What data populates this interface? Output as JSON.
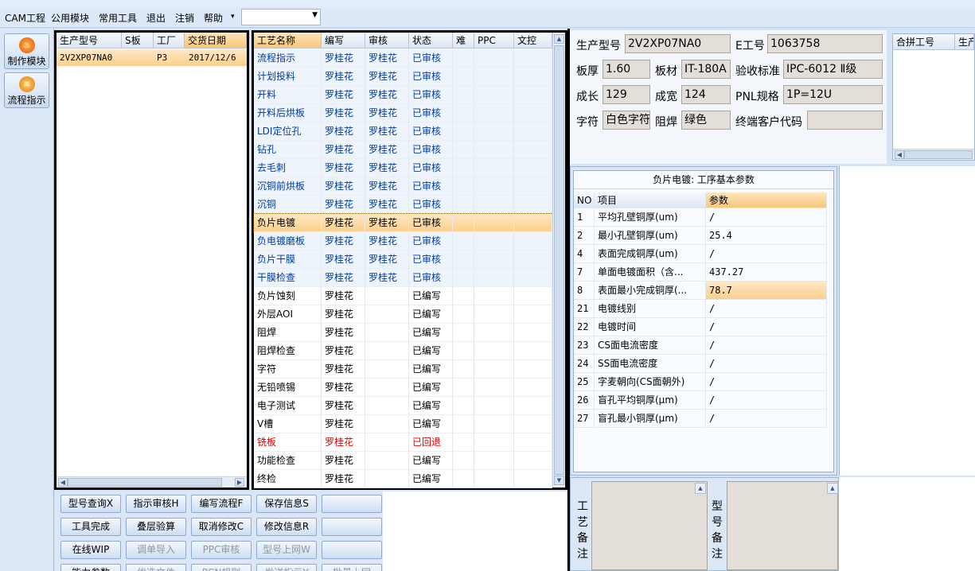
{
  "menu": {
    "items": [
      "CAM工程",
      "公用模块",
      "常用工具",
      "退出",
      "注销",
      "帮助"
    ],
    "dropdown_arrow": "▾",
    "combo_value": ""
  },
  "left_nav": {
    "make_module": "制作模块",
    "process_guide": "流程指示"
  },
  "product_grid": {
    "headers": [
      "生产型号",
      "S板",
      "工厂",
      "交货日期"
    ],
    "rows": [
      {
        "model": "2V2XP07NA0",
        "s_board": "",
        "factory": "P3",
        "delivery_date": "2017/12/6"
      }
    ]
  },
  "steps_grid": {
    "headers": [
      "工艺名称",
      "编写",
      "审核",
      "状态",
      "难",
      "PPC",
      "文控"
    ],
    "selected_index": 9,
    "rows": [
      {
        "name": "流程指示",
        "writer": "罗桂花",
        "reviewer": "罗桂花",
        "status": "已审核"
      },
      {
        "name": "计划投料",
        "writer": "罗桂花",
        "reviewer": "罗桂花",
        "status": "已审核"
      },
      {
        "name": "开料",
        "writer": "罗桂花",
        "reviewer": "罗桂花",
        "status": "已审核"
      },
      {
        "name": "开料后烘板",
        "writer": "罗桂花",
        "reviewer": "罗桂花",
        "status": "已审核"
      },
      {
        "name": "LDI定位孔",
        "writer": "罗桂花",
        "reviewer": "罗桂花",
        "status": "已审核"
      },
      {
        "name": "钻孔",
        "writer": "罗桂花",
        "reviewer": "罗桂花",
        "status": "已审核"
      },
      {
        "name": "去毛刺",
        "writer": "罗桂花",
        "reviewer": "罗桂花",
        "status": "已审核"
      },
      {
        "name": "沉铜前烘板",
        "writer": "罗桂花",
        "reviewer": "罗桂花",
        "status": "已审核"
      },
      {
        "name": "沉铜",
        "writer": "罗桂花",
        "reviewer": "罗桂花",
        "status": "已审核"
      },
      {
        "name": "负片电镀",
        "writer": "罗桂花",
        "reviewer": "罗桂花",
        "status": "已审核"
      },
      {
        "name": "负电镀磨板",
        "writer": "罗桂花",
        "reviewer": "罗桂花",
        "status": "已审核"
      },
      {
        "name": "负片干膜",
        "writer": "罗桂花",
        "reviewer": "罗桂花",
        "status": "已审核"
      },
      {
        "name": "干膜检查",
        "writer": "罗桂花",
        "reviewer": "罗桂花",
        "status": "已审核"
      },
      {
        "name": "负片蚀刻",
        "writer": "罗桂花",
        "reviewer": "",
        "status": "已编写"
      },
      {
        "name": "外层AOI",
        "writer": "罗桂花",
        "reviewer": "",
        "status": "已编写"
      },
      {
        "name": "阻焊",
        "writer": "罗桂花",
        "reviewer": "",
        "status": "已编写"
      },
      {
        "name": "阻焊检查",
        "writer": "罗桂花",
        "reviewer": "",
        "status": "已编写"
      },
      {
        "name": "字符",
        "writer": "罗桂花",
        "reviewer": "",
        "status": "已编写"
      },
      {
        "name": "无铅喷锡",
        "writer": "罗桂花",
        "reviewer": "",
        "status": "已编写"
      },
      {
        "name": "电子测试",
        "writer": "罗桂花",
        "reviewer": "",
        "status": "已编写"
      },
      {
        "name": "V槽",
        "writer": "罗桂花",
        "reviewer": "",
        "status": "已编写"
      },
      {
        "name": "铣板",
        "writer": "罗桂花",
        "reviewer": "",
        "status": "已回退"
      },
      {
        "name": "功能检查",
        "writer": "罗桂花",
        "reviewer": "",
        "status": "已编写"
      },
      {
        "name": "终检",
        "writer": "罗桂花",
        "reviewer": "",
        "status": "已编写"
      }
    ]
  },
  "buttons": {
    "row1": [
      "型号查询X",
      "指示审核H",
      "编写流程F",
      "保存信息S",
      ""
    ],
    "row2": [
      "工具完成",
      "叠层验算",
      "取消修改C",
      "修改信息R",
      ""
    ],
    "row3": [
      "在线WIP",
      "调单导入",
      "PPC审核",
      "型号上网W",
      ""
    ],
    "row4": [
      "能力参数",
      "优选文件",
      "PCN规则",
      "发送指示Y",
      "批量上网"
    ]
  },
  "info": {
    "model_label": "生产型号",
    "model": "2V2XP07NA0",
    "eno_label": "E工号",
    "eno": "1063758",
    "thickness_label": "板厚",
    "thickness": "1.60",
    "material_label": "板材",
    "material": "IT-180A",
    "standard_label": "验收标准",
    "standard": "IPC-6012 Ⅱ级",
    "length_label": "成长",
    "length": "129",
    "width_label": "成宽",
    "width": "124",
    "pnl_label": "PNL规格",
    "pnl": "1P=12U",
    "legend_label": "字符",
    "legend": "白色字符",
    "mask_label": "阻焊",
    "mask": "绿色",
    "enduser_label": "终端客户代码",
    "enduser": ""
  },
  "merge_panel": {
    "headers": [
      "合拼工号",
      "生产"
    ]
  },
  "params": {
    "title": "负片电镀: 工序基本参数",
    "headers": [
      "NO",
      "项目",
      "参数"
    ],
    "selected_index": 4,
    "rows": [
      {
        "no": "1",
        "item": "平均孔壁铜厚(um)",
        "value": "/"
      },
      {
        "no": "2",
        "item": "最小孔壁铜厚(um)",
        "value": "25.4"
      },
      {
        "no": "4",
        "item": "表面完成铜厚(um)",
        "value": "/"
      },
      {
        "no": "7",
        "item": "单面电镀面积（含...",
        "value": "437.27"
      },
      {
        "no": "8",
        "item": "表面最小完成铜厚(...",
        "value": "78.7"
      },
      {
        "no": "21",
        "item": "电镀线别",
        "value": "/"
      },
      {
        "no": "22",
        "item": "电镀时间",
        "value": "/"
      },
      {
        "no": "23",
        "item": "CS面电流密度",
        "value": "/"
      },
      {
        "no": "24",
        "item": "SS面电流密度",
        "value": "/"
      },
      {
        "no": "25",
        "item": "字麦朝向(CS面朝外)",
        "value": "/"
      },
      {
        "no": "26",
        "item": "盲孔平均铜厚(μm)",
        "value": "/"
      },
      {
        "no": "27",
        "item": "盲孔最小铜厚(μm)",
        "value": "/"
      }
    ]
  },
  "remarks": {
    "process_label": "工艺备注",
    "model_label": "型号备注"
  },
  "colors": {
    "selected_row": "#fbcf8c",
    "header_accent": "#f8c77a",
    "returned_status": "#e00000",
    "grid_text_blue": "#003ca0",
    "frame": "#000000"
  },
  "icons": {
    "make_module": "flame-icon",
    "process_guide": "flow-icon"
  }
}
